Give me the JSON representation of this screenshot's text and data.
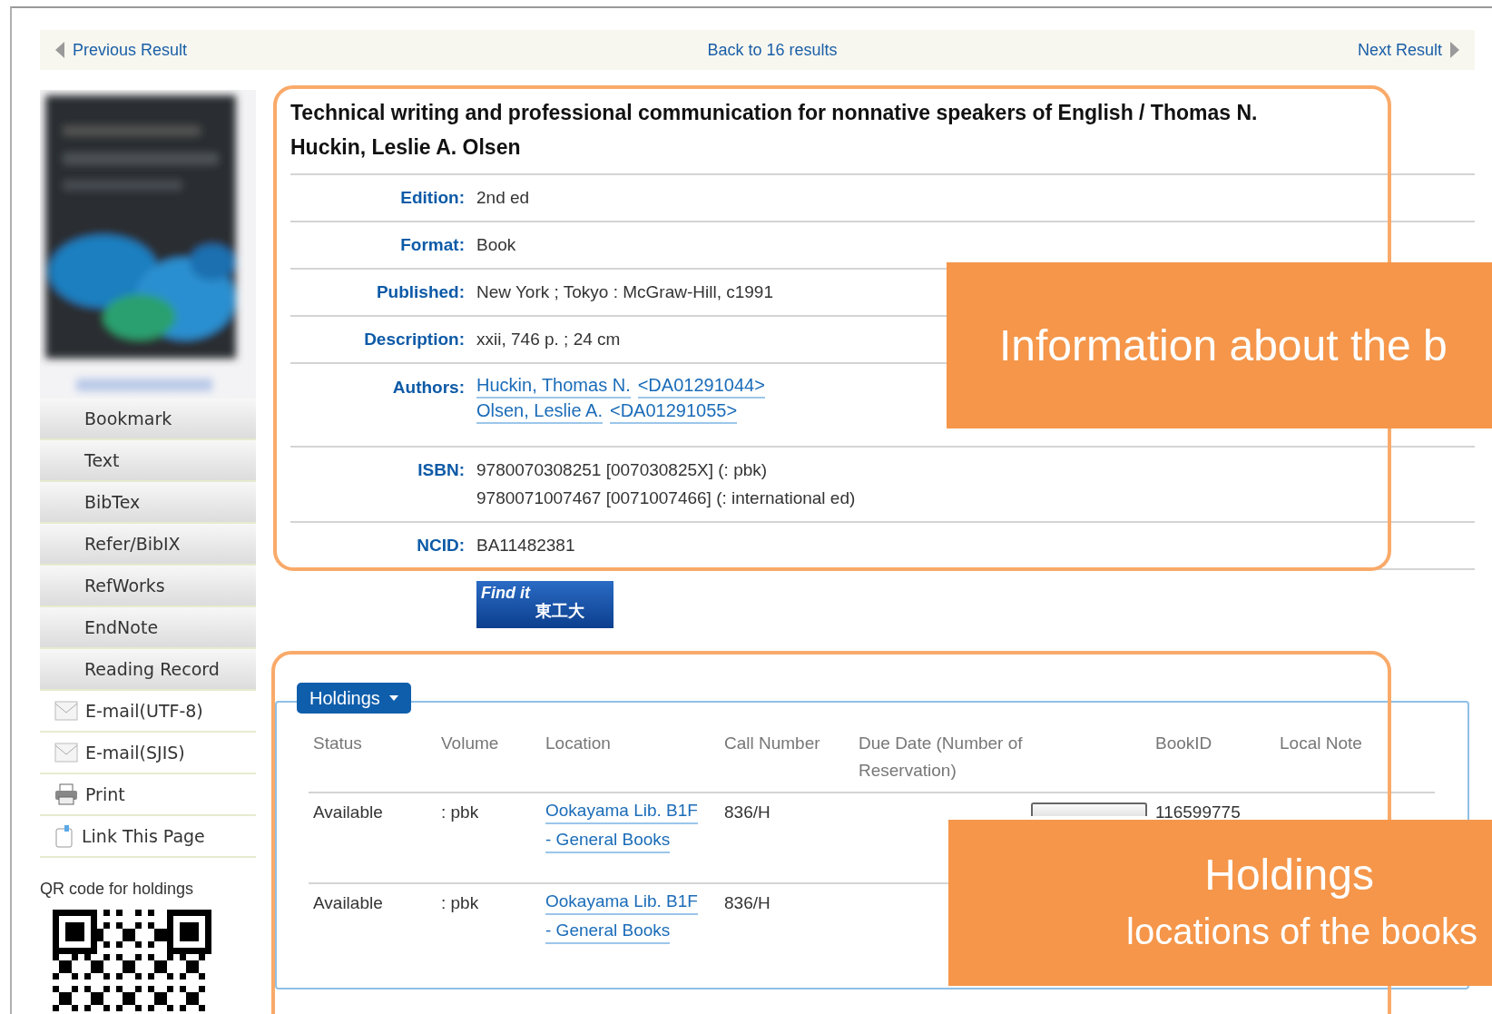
{
  "nav": {
    "previous": "Previous Result",
    "back": "Back to 16 results",
    "next": "Next Result"
  },
  "sidebar": {
    "menu": [
      {
        "label": "Bookmark",
        "kind": "export"
      },
      {
        "label": "Text",
        "kind": "export"
      },
      {
        "label": "BibTex",
        "kind": "export"
      },
      {
        "label": "Refer/BibIX",
        "kind": "export"
      },
      {
        "label": "RefWorks",
        "kind": "export"
      },
      {
        "label": "EndNote",
        "kind": "export"
      },
      {
        "label": "Reading Record",
        "kind": "export"
      },
      {
        "label": "E-mail(UTF-8)",
        "kind": "mail"
      },
      {
        "label": "E-mail(SJIS)",
        "kind": "mail"
      },
      {
        "label": "Print",
        "kind": "print"
      },
      {
        "label": "Link This Page",
        "kind": "link"
      }
    ],
    "qr_label": "QR code for holdings"
  },
  "record": {
    "title": "Technical writing and professional communication for nonnative speakers of English / Thomas N. Huckin, Leslie A. Olsen",
    "fields": [
      {
        "label": "Edition:",
        "kind": "text",
        "values": [
          "2nd ed"
        ]
      },
      {
        "label": "Format:",
        "kind": "text",
        "values": [
          "Book"
        ]
      },
      {
        "label": "Published:",
        "kind": "text",
        "values": [
          "New York ; Tokyo : McGraw-Hill, c1991"
        ]
      },
      {
        "label": "Description:",
        "kind": "text",
        "values": [
          "xxii, 746 p. ; 24 cm"
        ]
      },
      {
        "label": "Authors:",
        "kind": "links",
        "values": [
          "Huckin, Thomas N.",
          "<DA01291044>",
          "Olsen, Leslie A.",
          "<DA01291055>"
        ]
      },
      {
        "label": "ISBN:",
        "kind": "lines",
        "values": [
          "9780070308251 [007030825X] (: pbk)",
          "9780071007467 [0071007466] (: international ed)"
        ]
      },
      {
        "label": "NCID:",
        "kind": "text",
        "values": [
          "BA11482381"
        ]
      }
    ]
  },
  "find_it": {
    "text": "Find it",
    "text_2": "東工大"
  },
  "holdings": {
    "tab": "Holdings",
    "columns": [
      "Status",
      "Volume",
      "Location",
      "Call Number",
      "Due Date (Number of Reservation)",
      "BookID",
      "Local Note"
    ],
    "rows": [
      {
        "status": "Available",
        "volume": ": pbk",
        "location": [
          "Ookayama Lib. B1F",
          "- General Books"
        ],
        "call_number": "836/H",
        "reserve_button": true,
        "book_id": "116599775"
      },
      {
        "status": "Available",
        "volume": ": pbk",
        "location": [
          "Ookayama Lib. B1F",
          "- General Books"
        ],
        "call_number": "836/H"
      }
    ]
  },
  "callouts": [
    {
      "lines": [
        "Information about the b"
      ]
    },
    {
      "lines": [
        "Holdings",
        "locations of the books"
      ]
    }
  ]
}
